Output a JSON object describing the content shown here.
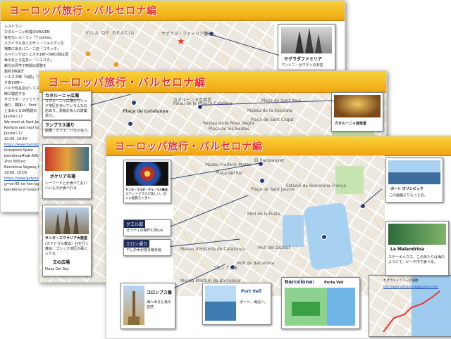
{
  "slide1": {
    "title": "ヨーロッパ旅行・バルセロナ編",
    "left_lines": [
      "レストラン",
      "カタルーニャ料理のORIGEN",
      "有名なレストラン「7 portes」",
      "スカイラル近くのサン・ジョルディ広",
      "場角にあるバニーニ店「コネッタ」",
      "",
      "スペインではシエスタ1時〜5時の間は昼",
      "休みをとる店多い「シエスタ」",
      "観光の見学で時間の調整を",
      "",
      "最終1時過ぎ",
      "シエスタ時「出勤」「活動」",
      "夕食19時〜",
      "バルや有名店はシエスタ",
      "時に開店する",
      "",
      "サグラダ・ファミリアのガウディ",
      "通り、隣接い、Pont",
      "とまめぐる36階建の",
      "Jaume I 1?",
      "",
      "We meet at Sant Jaume",
      "Rambla and next to metro",
      "Jaume I 1?",
      "10:30, 14:30",
      "https://www.barcelona",
      "fe/explore-Spain",
      "barcelona#tab-AllUs##",
      "2hrs 56Euro",
      "Barcelona Segway Glid",
      "19:00, 15:00",
      "https://www.getyourgu",
      "g=ee-95-no-hen-bge/a",
      "barcelona-2-hours-66"
    ],
    "map_labels": [
      "VILA DE GRÀCIA",
      "サグラダ・ファミリア聖堂",
      "Sagrada Familia"
    ],
    "photo_title": "サグラダファミリア",
    "photo_caption": "アントニ・ガウディの未完"
  },
  "slide2": {
    "title": "ヨーロッパ旅行・バルセロナ編",
    "box1_label": "カタルーニャ広場",
    "box1_text": "カタルーニャ広場からシック地区を歩いていろんなお店あり、素敵お気入の建築あり。",
    "box2_label": "ランブラス通り",
    "box2_text": "劇場、カフェ、バルがあり。",
    "photo1_title": "ボケリア市場",
    "photo1_text": "シーフードとか食べておいいいものが食べれる",
    "photo2_title": "サンタ・エウラリア大聖堂",
    "photo2_text": "(カテドラル教会）社を行く教会、ゴシック地区の裏に入りる",
    "photo2_sub": "王の広場",
    "photo2_sub2": "Plaza Del Rey",
    "map_labels": [
      "カタルーニャ音楽堂",
      "Palau de la Música Catalana",
      "Plaça de Catalunya",
      "Museu de la Xocolata",
      "Restaurante Rosa Negra",
      "Plaça de Sant Cugat",
      "Plaça de les Beates",
      "Plaça de la Llana",
      "Plaça de Sant Pere",
      "Mercat"
    ],
    "music_hall_caption": "カタルーニャ音楽堂"
  },
  "slide3": {
    "title": "ヨーロッパ旅行・バルセロナ編",
    "stained_title": "サンタ・マルダ・デル・マル教会",
    "stained_text": "ステンドグラスが美しい、近くに観覧を入手い",
    "guell_label": "グエル邸",
    "guell_text": "ガウディの傑作12Euro",
    "reial_label": "エロン通り",
    "reial_text": "やしの木が茂る散歩道",
    "colon_title": "コロンブス像",
    "colon_text": "海へ出ると良の自然",
    "portvell_title": "Port Vell",
    "portvell_text": "ボート、海沿い。",
    "barcelona_title": "Barcelona:",
    "barcelona_sub": "Porta Vell",
    "port_title": "ボート オリンピック",
    "port_text": "この画面よりもっとお。",
    "malandrina_title": "La Malandrina",
    "malandrina_text": "ステーキハウス、このあたりは海のようにて、ビーチ中で食べる。",
    "segway_title": "セグウェイツアーの道順",
    "segway_url": "http://www.barcelonasegwaytours.com",
    "map_labels": [
      "El Xampanyet",
      "Museu Frederic Marès",
      "Plaça del Rei",
      "Plaça Reial",
      "Plaça de Sant Jaume",
      "Moll d'Espanya",
      "Moll de la Fusta",
      "Port Vell",
      "Aquàrium Barcelona",
      "Estació de Barcelona-França",
      "Parc de la Ciutadella",
      "Museu Marítim de Barcelona",
      "Moll de Barcelona",
      "Moll d'Espanya",
      "Plaça de Pau Vila",
      "Museu d'Història de Catalunya",
      "Moll del Dipòsit",
      "Plaça del Duc de Medinaceli",
      "コロンブス像"
    ]
  }
}
